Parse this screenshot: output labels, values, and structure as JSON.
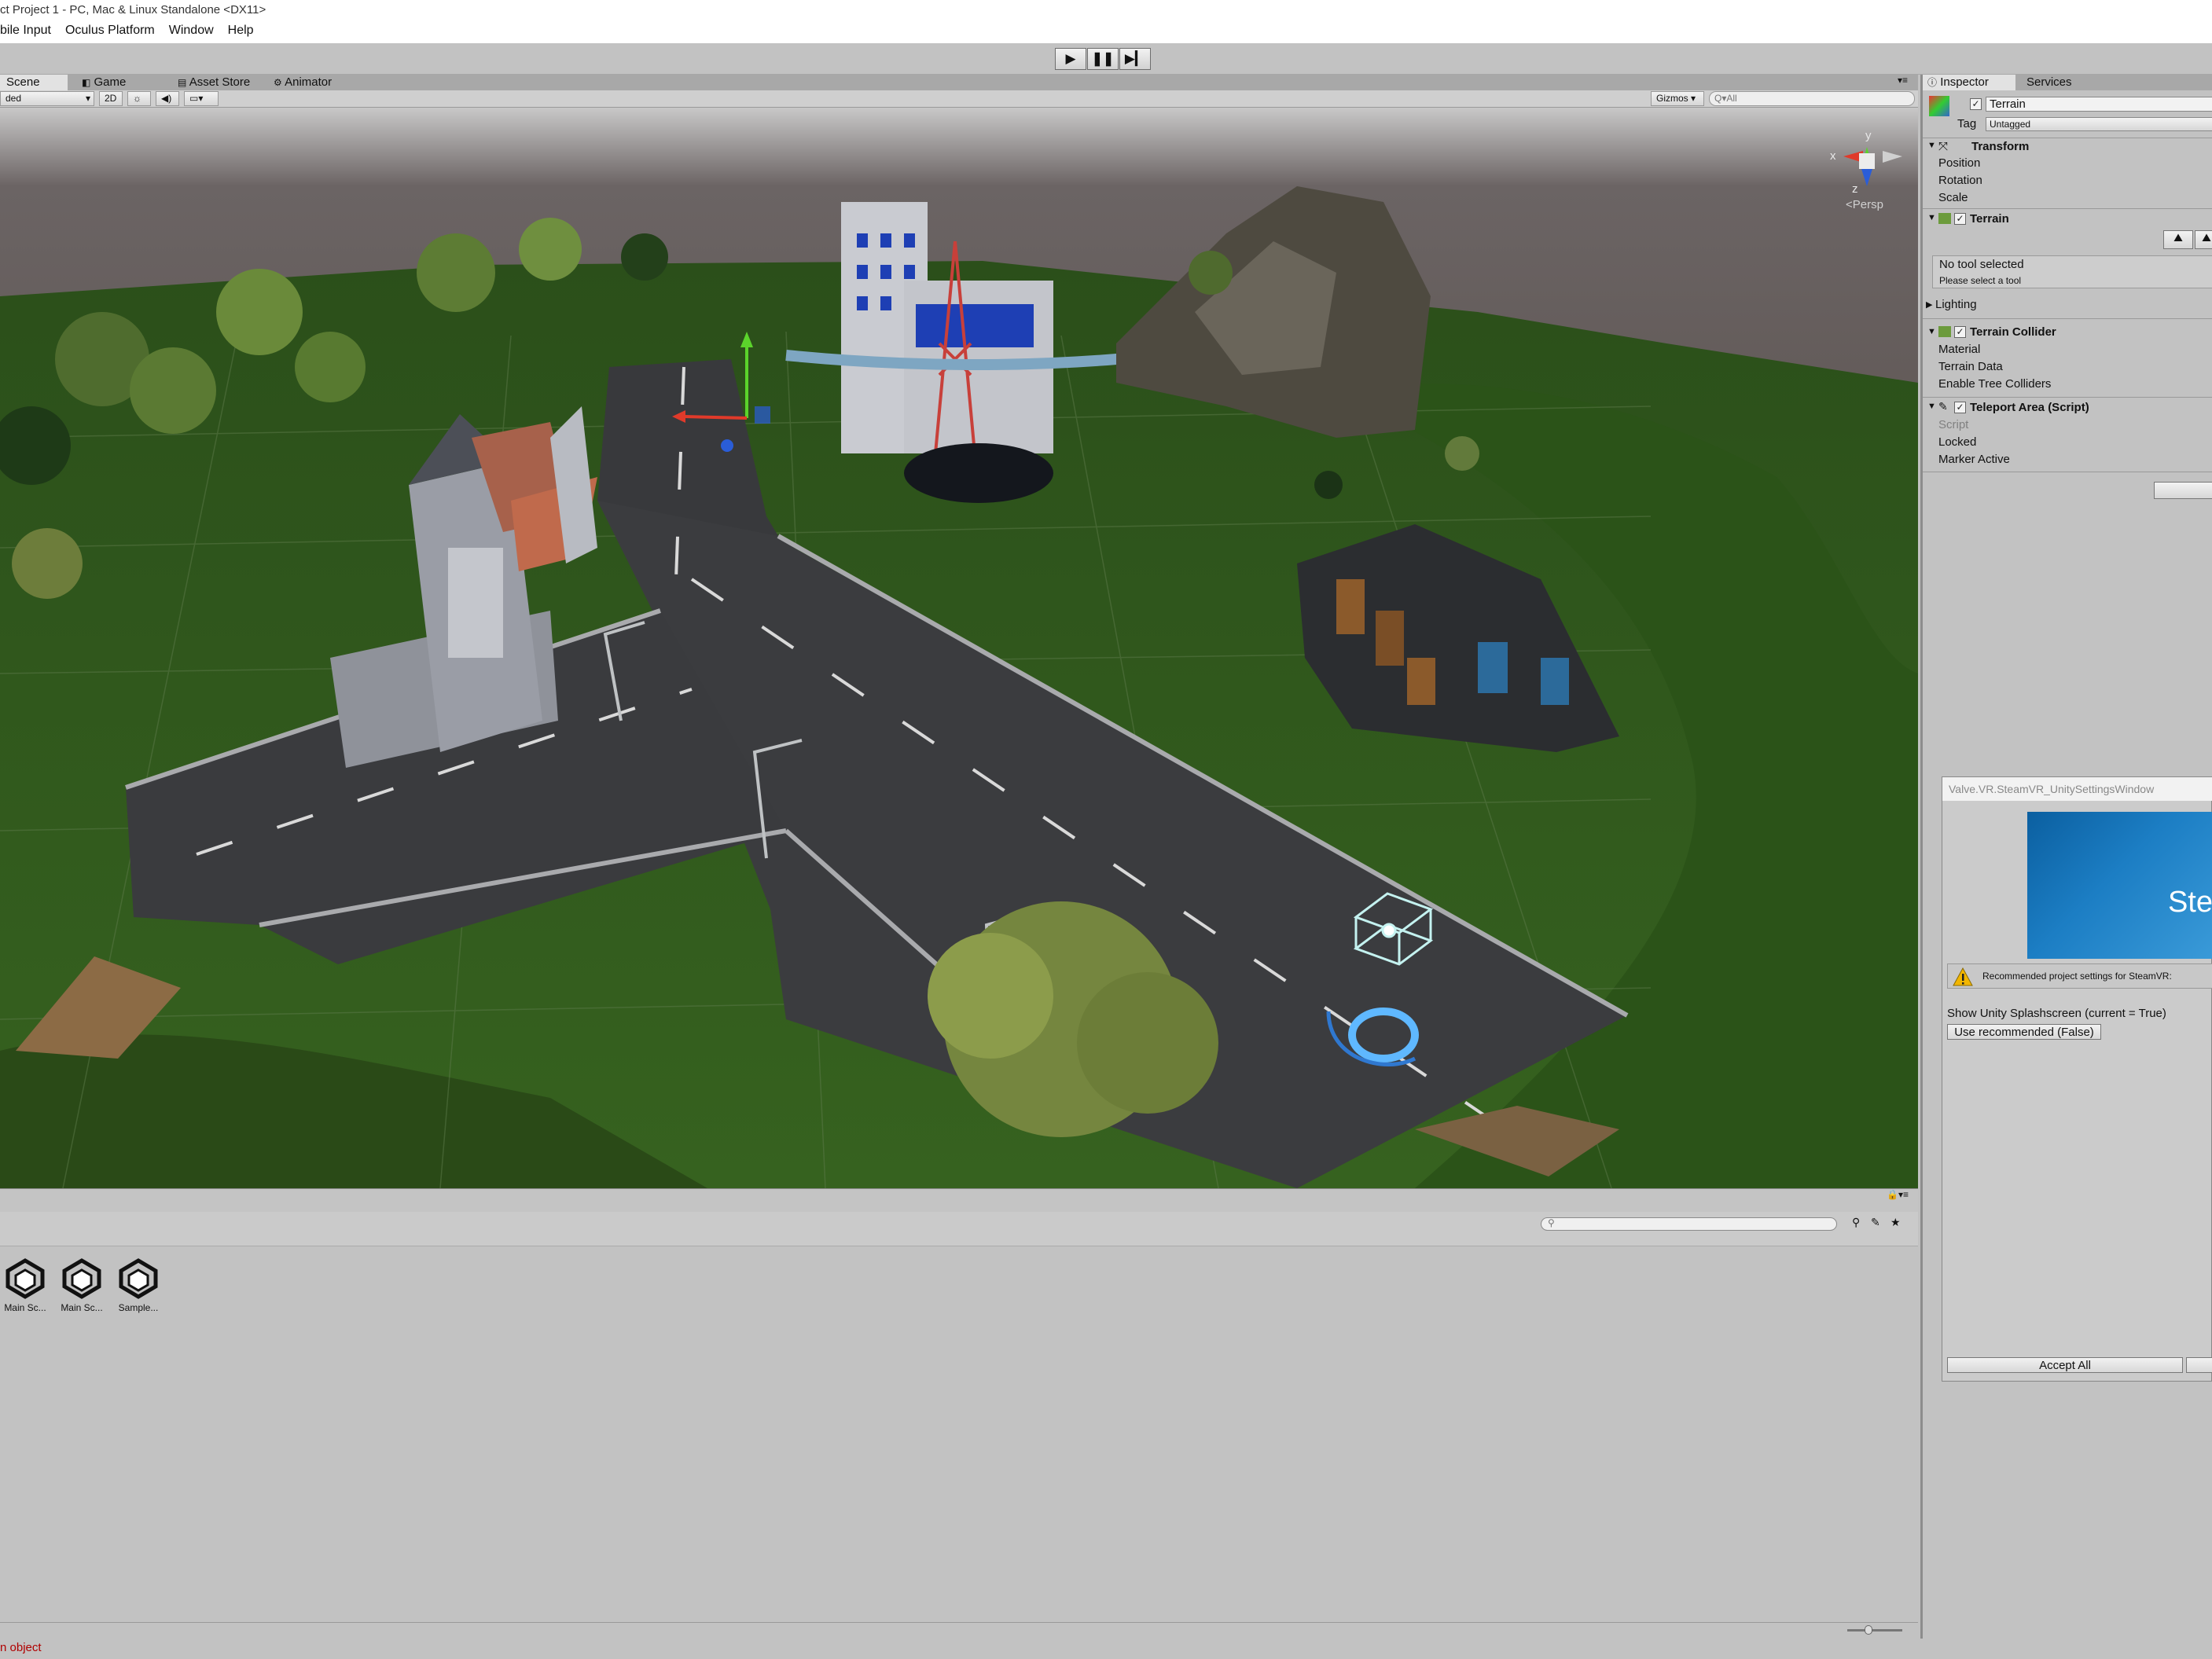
{
  "window": {
    "title": "ct Project 1 - PC, Mac & Linux Standalone <DX11>"
  },
  "menu": {
    "items": [
      "bile Input",
      "Oculus Platform",
      "Window",
      "Help"
    ]
  },
  "playbar": {
    "play_icon": "play-icon",
    "pause_icon": "pause-icon",
    "step_icon": "step-icon"
  },
  "tabs": {
    "scene": "Scene",
    "game": "Game",
    "asset_store": "Asset Store",
    "animator": "Animator"
  },
  "scene_toolbar": {
    "shading_mode": "ded",
    "mode_2d": "2D",
    "gizmos": "Gizmos",
    "search_placeholder": "Q▾All"
  },
  "scene_gizmo": {
    "projection": "Persp",
    "x_label": "x",
    "y_label": "y",
    "z_label": "z"
  },
  "project": {
    "assets": [
      {
        "name": "Main Sc..."
      },
      {
        "name": "Main Sc..."
      },
      {
        "name": "Sample..."
      }
    ]
  },
  "status": {
    "message": "n object"
  },
  "inspector": {
    "tabs": {
      "inspector": "Inspector",
      "services": "Services"
    },
    "object_name": "Terrain",
    "tag_label": "Tag",
    "tag_value": "Untagged",
    "transform": {
      "title": "Transform",
      "position": "Position",
      "rotation": "Rotation",
      "scale": "Scale"
    },
    "terrain": {
      "title": "Terrain",
      "no_tool": "No tool selected",
      "select_tool": "Please select a tool",
      "lighting": "Lighting"
    },
    "terrain_collider": {
      "title": "Terrain Collider",
      "material": "Material",
      "terrain_data": "Terrain Data",
      "enable_tree_colliders": "Enable Tree Colliders"
    },
    "teleport_area": {
      "title": "Teleport Area (Script)",
      "script": "Script",
      "locked": "Locked",
      "marker_active": "Marker Active"
    }
  },
  "steamvr_dialog": {
    "title": "Valve.VR.SteamVR_UnitySettingsWindow",
    "banner_text": "Ste",
    "warning": "Recommended project settings for SteamVR:",
    "setting": "Show Unity Splashscreen (current = True)",
    "use_recommended": "Use recommended (False)",
    "accept_all": "Accept All"
  },
  "colors": {
    "grass": "#2f5320",
    "road": "#3b3d40",
    "sky": "#6f6868",
    "accent_blue": "#1e6ee6",
    "editor_gray": "#c2c2c2"
  }
}
